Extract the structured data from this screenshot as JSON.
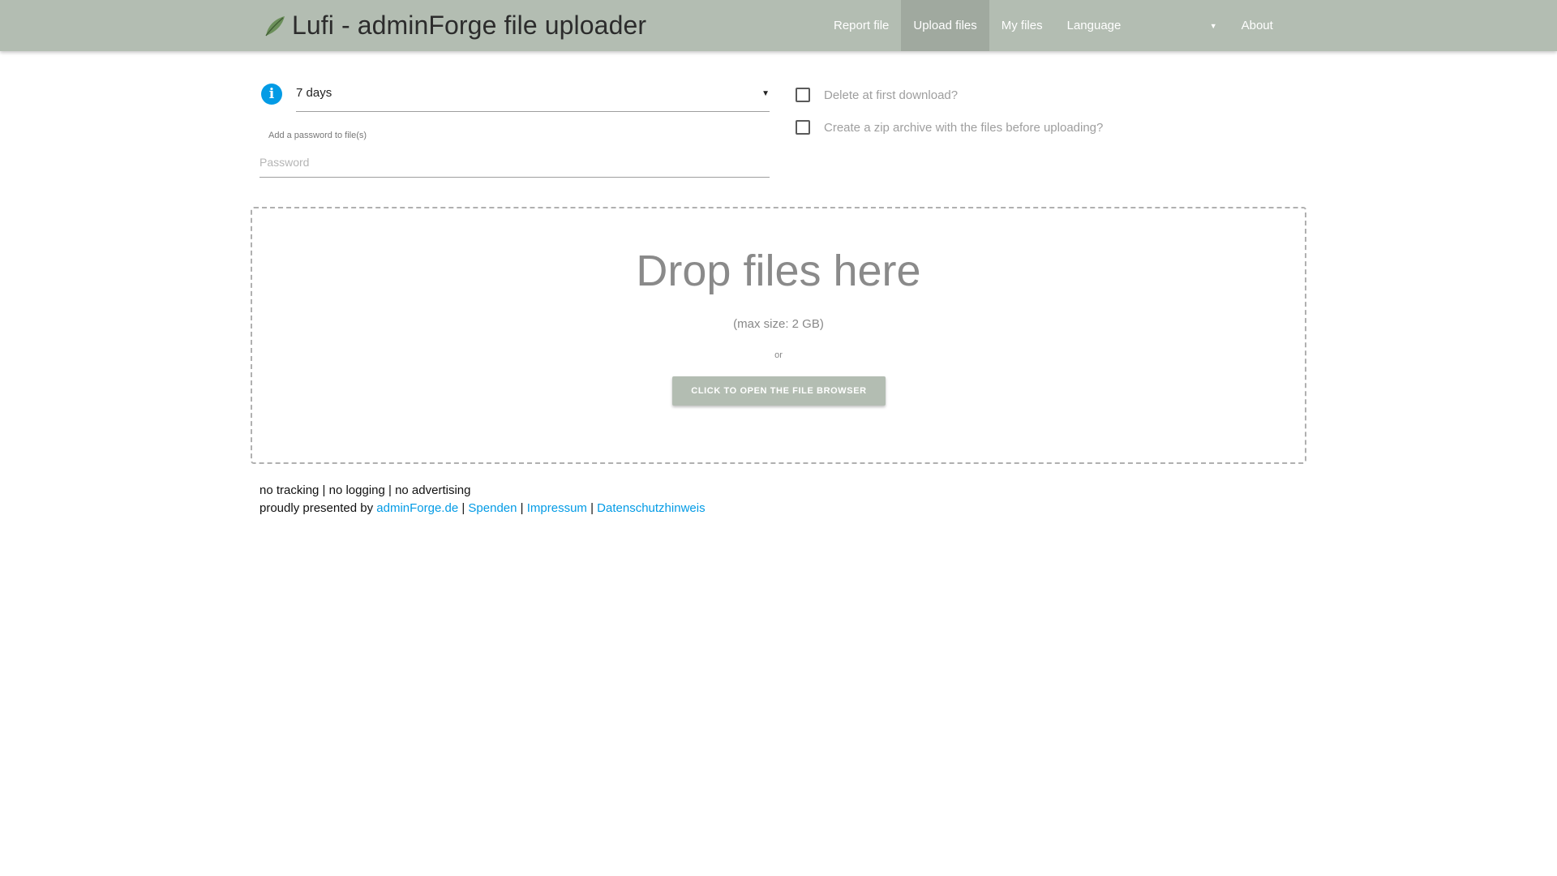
{
  "header": {
    "brand_title": "Lufi - adminForge file uploader",
    "nav": [
      {
        "label": "Report file"
      },
      {
        "label": "Upload files",
        "active": true
      },
      {
        "label": "My files"
      },
      {
        "label": "Language"
      },
      {
        "label": "About"
      }
    ]
  },
  "options": {
    "delay_value": "7 days",
    "password_label": "Add a password to file(s)",
    "password_placeholder": "Password",
    "password_value": "",
    "delete_first_download": {
      "label": "Delete at first download?",
      "checked": false
    },
    "zip_archive": {
      "label": "Create a zip archive with the files before uploading?",
      "checked": false
    }
  },
  "dropzone": {
    "title": "Drop files here",
    "max_size": "(max size: 2 GB)",
    "or": "or",
    "button_label": "Click to open the file browser"
  },
  "footer": {
    "line1": "no tracking | no logging | no advertising",
    "presented_by": "proudly presented by",
    "links": [
      "adminForge.de",
      "Spenden",
      "Impressum",
      "Datenschutzhinweis"
    ],
    "separator": "|"
  },
  "colors": {
    "navbar": "#b3bdb2",
    "accent": "#039be5",
    "logo_leaf": "#6b8f5a"
  },
  "icons": {
    "logo": "leaf-logo-icon",
    "info": "info-icon",
    "dropdown": "chevron-down-icon"
  }
}
